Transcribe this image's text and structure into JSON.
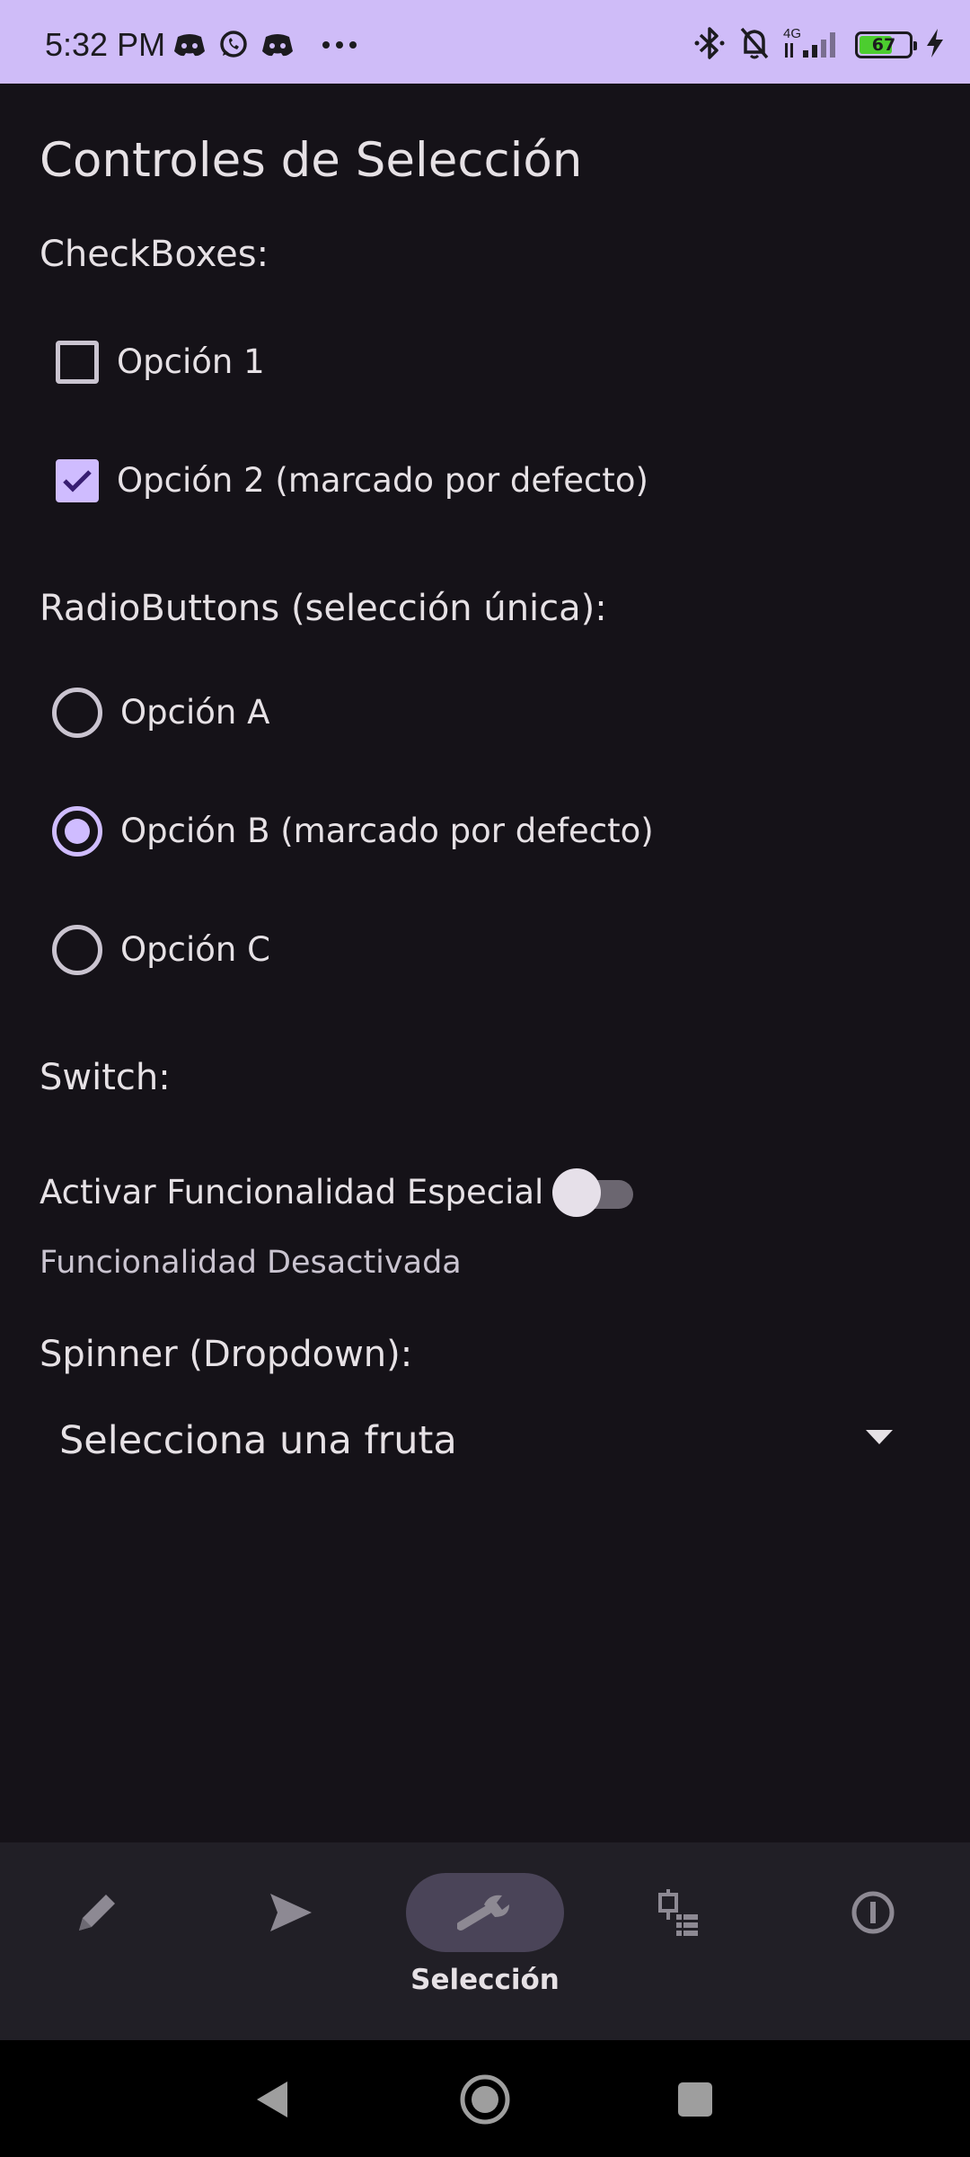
{
  "status_bar": {
    "time": "5:32 PM",
    "left_icons": [
      "discord-icon",
      "whatsapp-icon",
      "discord-icon",
      "more-dots-icon"
    ],
    "right_icons": [
      "bluetooth-icon",
      "notifications-off-icon",
      "signal-4g-icon",
      "battery-icon",
      "charging-icon"
    ],
    "network_label": "4G",
    "battery_level": 67,
    "battery_text": "67"
  },
  "page": {
    "title": "Controles de Selección"
  },
  "checkboxes": {
    "label": "CheckBoxes:",
    "items": [
      {
        "label": "Opción 1",
        "checked": false
      },
      {
        "label": "Opción 2 (marcado por defecto)",
        "checked": true
      }
    ]
  },
  "radios": {
    "label": "RadioButtons (selección única):",
    "items": [
      {
        "label": "Opción A",
        "checked": false
      },
      {
        "label": "Opción B (marcado por defecto)",
        "checked": true
      },
      {
        "label": "Opción C",
        "checked": false
      }
    ]
  },
  "switch": {
    "label": "Switch:",
    "text": "Activar Funcionalidad Especial",
    "on": false,
    "status": "Funcionalidad Desactivada"
  },
  "spinner": {
    "label": "Spinner (Dropdown):",
    "selected": "Selecciona una fruta"
  },
  "bottom_nav": {
    "items": [
      {
        "icon": "pencil-icon",
        "label": "",
        "active": false
      },
      {
        "icon": "send-icon",
        "label": "",
        "active": false
      },
      {
        "icon": "wrench-icon",
        "label": "Selección",
        "active": true
      },
      {
        "icon": "list-icon",
        "label": "",
        "active": false
      },
      {
        "icon": "info-icon",
        "label": "",
        "active": false
      }
    ]
  },
  "system_nav": {
    "buttons": [
      "back-icon",
      "home-icon",
      "recents-icon"
    ]
  },
  "colors": {
    "status_bar": "#cfbcf8",
    "background": "#151218",
    "accent": "#cfbcff",
    "nav_background": "#211f26",
    "nav_active_pill": "#4a4458",
    "battery_fill": "#4ccd2f"
  }
}
